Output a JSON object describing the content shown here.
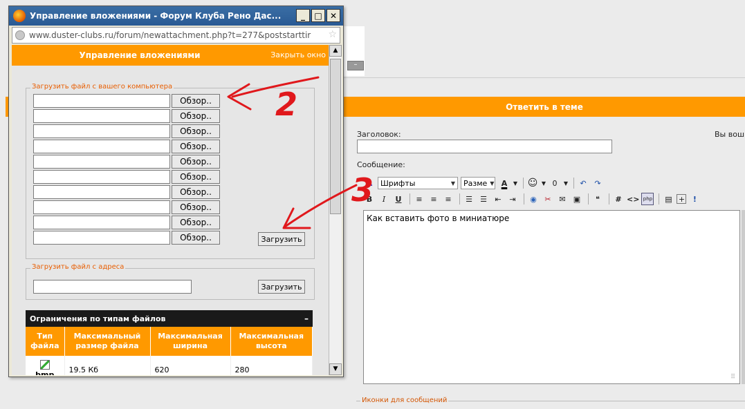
{
  "popup": {
    "title": "Управление вложениями - Форум Клуба Рено Дас...",
    "url": "www.duster-clubs.ru/forum/newattachment.php?t=277&poststarttir",
    "header_title": "Управление вложениями",
    "close_link": "Закрыть окно",
    "upload_local": {
      "legend": "Загрузить файл с вашего компьютера",
      "browse_labels": [
        "Обзор..",
        "Обзор..",
        "Обзор..",
        "Обзор..",
        "Обзор..",
        "Обзор..",
        "Обзор..",
        "Обзор..",
        "Обзор..",
        "Обзор.."
      ],
      "upload_button": "Загрузить"
    },
    "upload_url": {
      "legend": "Загрузить файл с адреса",
      "upload_button": "Загрузить"
    },
    "limits": {
      "title": "Ограничения по типам файлов",
      "collapse_symbol": "–",
      "columns": [
        "Тип файла",
        "Максимальный размер файла",
        "Максимальная ширина",
        "Максимальная высота"
      ],
      "rows": [
        {
          "type": "bmp",
          "max_size": "19.5 Кб",
          "max_width": "620",
          "max_height": "280"
        }
      ]
    },
    "window_buttons": {
      "minimize": "_",
      "maximize": "□",
      "close": "✕"
    }
  },
  "forum": {
    "reply_header": "Ответить в теме",
    "title_label": "Заголовок:",
    "user_text": "Вы вош",
    "message_label": "Сообщение:",
    "font_select": "Шрифты",
    "size_select": "Разме",
    "message_text": "Как вставить фото в миниатюре",
    "icons_legend": "Иконки для сообщений",
    "mini_button": "–"
  },
  "annotations": {
    "label_2": "2",
    "label_3": "3",
    "color": "#e0181c"
  }
}
